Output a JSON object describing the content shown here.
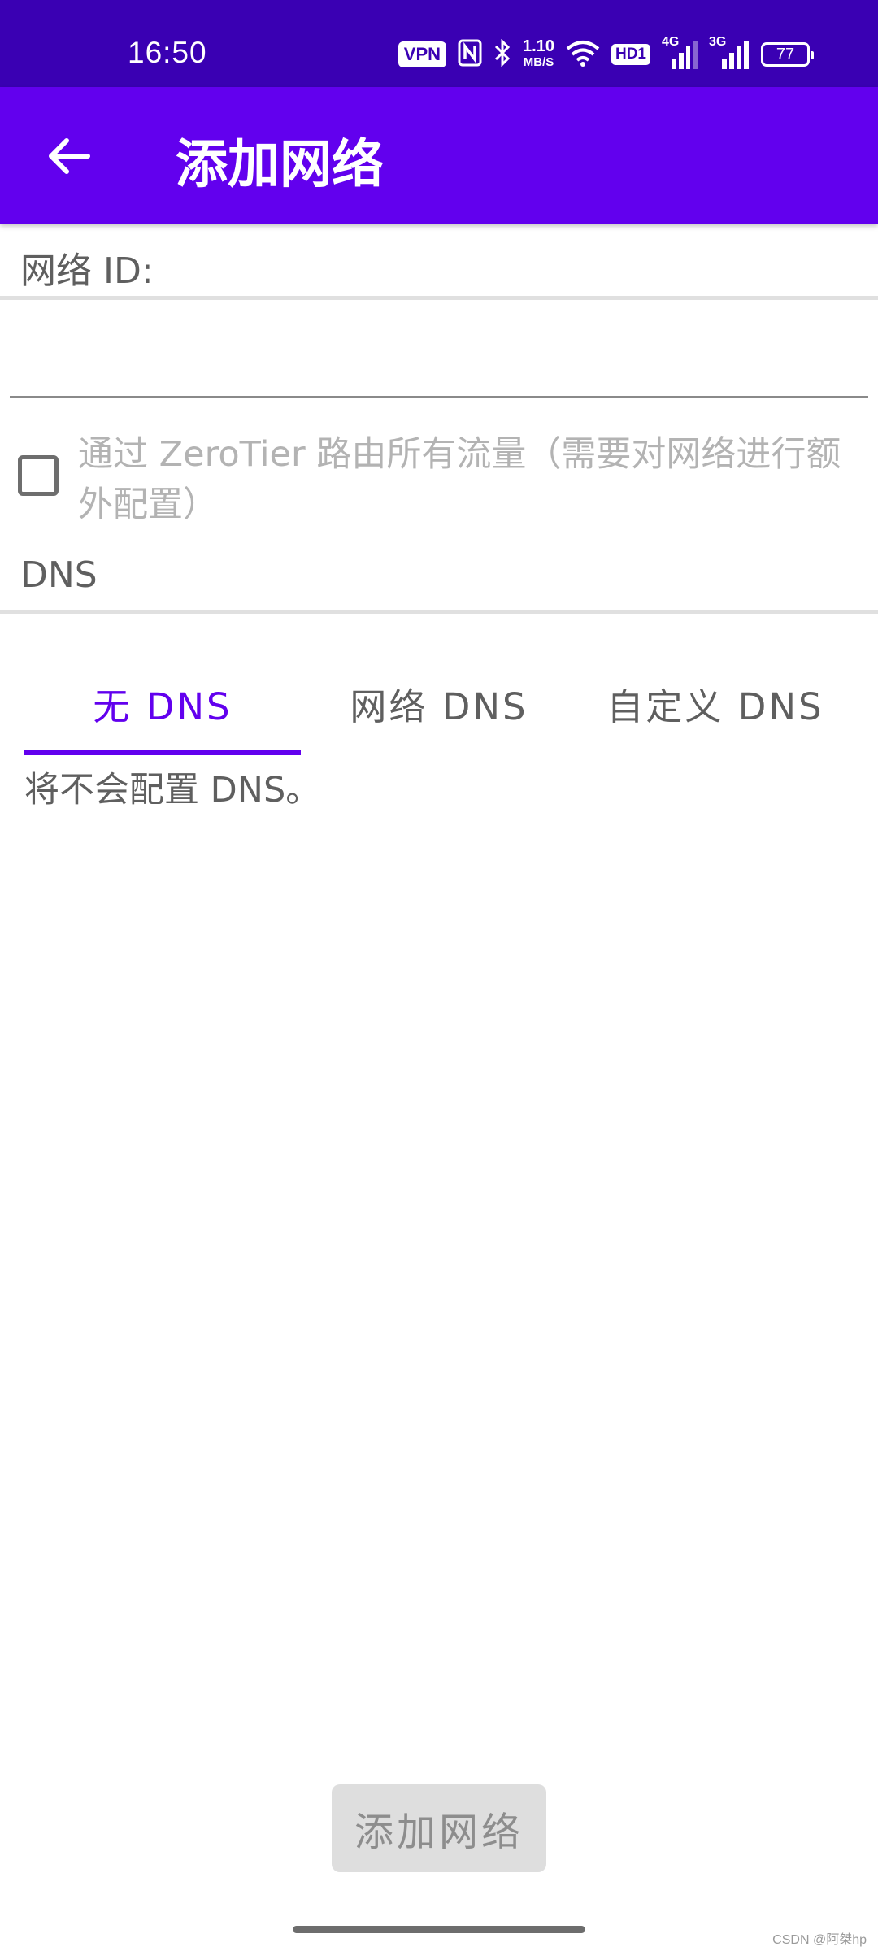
{
  "status_bar": {
    "time": "16:50",
    "vpn": "VPN",
    "nfc_icon": "nfc-icon",
    "bluetooth_icon": "bluetooth-icon",
    "net_speed_value": "1.10",
    "net_speed_unit": "MB/S",
    "wifi_icon": "wifi-icon",
    "hd": "HD1",
    "signal_1_label": "4G",
    "signal_2_label": "3G",
    "battery": "77"
  },
  "app_bar": {
    "back_icon": "arrow-back-icon",
    "title": "添加网络",
    "color": "#6200ee"
  },
  "form": {
    "network_id_label": "网络 ID:",
    "network_id_value": "",
    "route_all_checkbox_checked": false,
    "route_all_label": "通过 ZeroTier 路由所有流量（需要对网络进行额外配置）",
    "dns_label": "DNS"
  },
  "dns_tabs": {
    "items": [
      {
        "label": "无 DNS",
        "selected": true
      },
      {
        "label": "网络 DNS",
        "selected": false
      },
      {
        "label": "自定义 DNS",
        "selected": false
      }
    ],
    "description": "将不会配置 DNS。"
  },
  "add_button": {
    "label": "添加网络",
    "enabled": false
  },
  "watermark": "CSDN @阿桀hp",
  "colors": {
    "status_bar": "#3a00b3",
    "accent": "#6200ee",
    "button_disabled_bg": "#dedede"
  }
}
